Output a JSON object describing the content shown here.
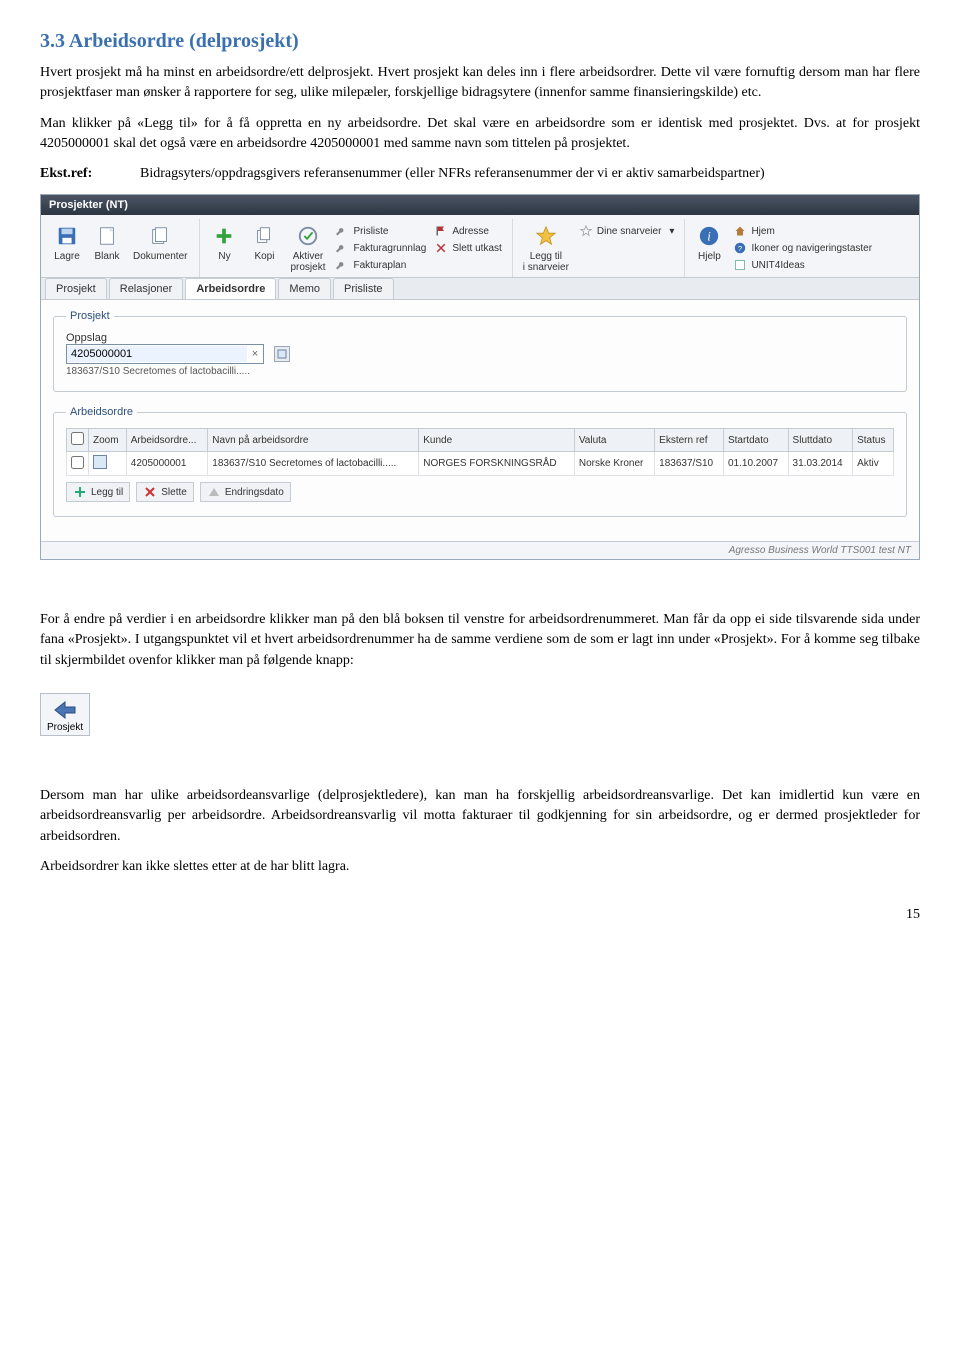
{
  "section": {
    "number": "3.3",
    "title": "Arbeidsordre",
    "paren": "(delprosjekt)"
  },
  "para1": "Hvert prosjekt må ha minst en arbeidsordre/ett delprosjekt. Hvert prosjekt kan deles inn i flere arbeidsordrer. Dette vil være fornuftig dersom man har flere prosjektfaser man ønsker å rapportere for seg, ulike milepæler, forskjellige bidragsytere (innenfor samme finansieringskilde) etc.",
  "para2": "Man klikker på «Legg til» for å få oppretta en ny arbeidsordre. Det skal være en arbeidsordre som er identisk med prosjektet. Dvs. at for prosjekt 4205000001 skal det også være en arbeidsordre 4205000001 med samme navn som tittelen på prosjektet.",
  "ekst_label": "Ekst.ref:",
  "ekst_text": "Bidragsyters/oppdragsgivers referansenummer (eller NFRs referansenummer der vi er aktiv samarbeidspartner)",
  "app": {
    "title": "Prosjekter (NT)",
    "ribbon_large": [
      {
        "name": "lagre",
        "label": "Lagre"
      },
      {
        "name": "blank",
        "label": "Blank"
      },
      {
        "name": "dokumenter",
        "label": "Dokumenter"
      },
      {
        "name": "ny",
        "label": "Ny"
      },
      {
        "name": "kopi",
        "label": "Kopi"
      },
      {
        "name": "aktiver",
        "label": "Aktiver\nprosjekt"
      }
    ],
    "ribbon_small_a": [
      {
        "name": "prisliste",
        "label": "Prisliste"
      },
      {
        "name": "fakturagrunnlag",
        "label": "Fakturagrunnlag"
      },
      {
        "name": "fakturaplan",
        "label": "Fakturaplan"
      }
    ],
    "ribbon_small_b": [
      {
        "name": "adresse",
        "label": "Adresse"
      },
      {
        "name": "slett-utkast",
        "label": "Slett utkast"
      }
    ],
    "ribbon_fav": {
      "name": "legg-snarveier",
      "label": "Legg til\ni snarveier",
      "top": "Dine snarveier"
    },
    "ribbon_help": {
      "name": "hjelp",
      "label": "Hjelp"
    },
    "ribbon_small_c": [
      {
        "name": "hjem",
        "label": "Hjem"
      },
      {
        "name": "ikoner",
        "label": "Ikoner og navigeringstaster"
      },
      {
        "name": "unit4",
        "label": "UNIT4Ideas"
      }
    ],
    "tabs": [
      "Prosjekt",
      "Relasjoner",
      "Arbeidsordre",
      "Memo",
      "Prisliste"
    ],
    "active_tab": 2,
    "fieldset1": "Prosjekt",
    "oppslag_label": "Oppslag",
    "oppslag_value": "4205000001",
    "oppslag_hint": "183637/S10 Secretomes of lactobacilli.....",
    "fieldset2": "Arbeidsordre",
    "columns": [
      "",
      "Zoom",
      "Arbeidsordre...",
      "Navn på arbeidsordre",
      "Kunde",
      "Valuta",
      "Ekstern ref",
      "Startdato",
      "Sluttdato",
      "Status"
    ],
    "row": {
      "arbeidsordre": "4205000001",
      "navn": "183637/S10 Secretomes of lactobacilli.....",
      "kunde": "NORGES FORSKNINGSRÅD",
      "valuta": "Norske Kroner",
      "ekstern": "183637/S10",
      "start": "01.10.2007",
      "slutt": "31.03.2014",
      "status": "Aktiv"
    },
    "under_buttons": [
      {
        "name": "legg-til",
        "label": "Legg til"
      },
      {
        "name": "slette",
        "label": "Slette"
      },
      {
        "name": "endringsdato",
        "label": "Endringsdato"
      }
    ],
    "statusbar": "Agresso Business World  TTS001  test  NT"
  },
  "para3": "For å endre på verdier i en arbeidsordre klikker man på den blå boksen til venstre for arbeidsordrenummeret. Man får da opp ei side tilsvarende sida under fana «Prosjekt». I utgangspunktet vil et hvert arbeidsordrenummer ha de samme verdiene som de som er lagt inn under «Prosjekt». For å komme seg tilbake til skjermbildet ovenfor klikker man på følgende knapp:",
  "back_label": "Prosjekt",
  "para4": "Dersom man har ulike arbeidsordeansvarlige (delprosjektledere), kan man ha forskjellig arbeidsordreansvarlige. Det kan imidlertid kun være en arbeidsordreansvarlig per arbeidsordre. Arbeidsordreansvarlig vil motta fakturaer til godkjenning for sin arbeidsordre, og er dermed prosjektleder for arbeidsordren.",
  "para5": "Arbeidsordrer kan ikke slettes etter at de har blitt lagra.",
  "page_num": "15"
}
